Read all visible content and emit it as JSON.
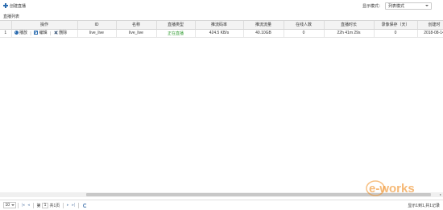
{
  "toolbar": {
    "add_label": "创建直播",
    "display_mode_label": "显示模式：",
    "display_mode_value": "列表模式"
  },
  "panel": {
    "title": "直播列表"
  },
  "table": {
    "columns": [
      "",
      "操作",
      "ID",
      "名称",
      "直播类型",
      "推流码率",
      "推流流量",
      "在线人数",
      "直播时长",
      "录像保存（天）",
      "创建时"
    ],
    "rows": [
      {
        "index": "1",
        "actions": {
          "play": "播放",
          "edit": "编辑",
          "delete": "删除"
        },
        "id": "live_live",
        "name": "live_live",
        "type": "正在直播",
        "bitrate": "424.5 KB/s",
        "traffic": "40.10GB",
        "online": "0",
        "duration": "22h 41m 29s",
        "retention": "0",
        "created": "2018-08-14"
      }
    ]
  },
  "pager": {
    "page_size": "10",
    "page_prefix": "第",
    "current_page": "1",
    "page_suffix": "共1页",
    "summary": "显示1到1,共1记录",
    "first": "|◂",
    "prev": "◂",
    "next": "▸",
    "last": "▸|"
  },
  "watermark": {
    "text": "e-works"
  },
  "colors": {
    "accent": "#2b6cb0",
    "live_status": "#2e9a2e",
    "watermark": "#f08c1e"
  }
}
